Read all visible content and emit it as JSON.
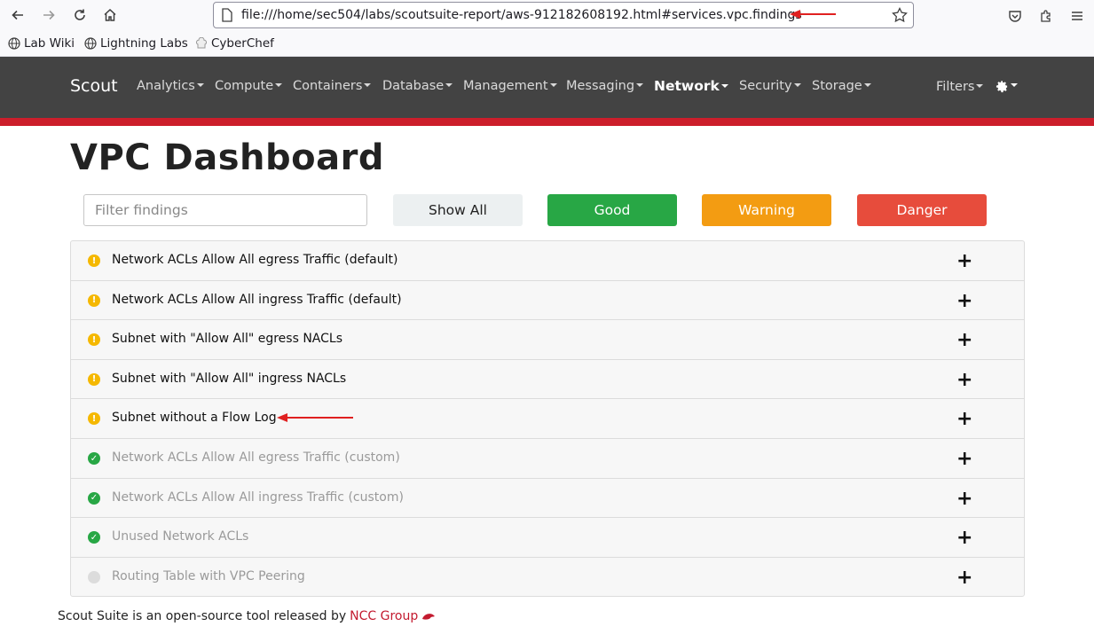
{
  "browser": {
    "url": "file:///home/sec504/labs/scoutsuite-report/aws-912182608192.html#services.vpc.findings",
    "bookmarks": [
      "Lab Wiki",
      "Lightning Labs",
      "CyberChef"
    ]
  },
  "navbar": {
    "brand": "Scout",
    "items": [
      "Analytics",
      "Compute",
      "Containers",
      "Database",
      "Management",
      "Messaging",
      "Network",
      "Security",
      "Storage"
    ],
    "active": "Network",
    "filters": "Filters"
  },
  "page": {
    "title": "VPC Dashboard",
    "filter_placeholder": "Filter findings",
    "buttons": {
      "show_all": "Show All",
      "good": "Good",
      "warning": "Warning",
      "danger": "Danger"
    }
  },
  "findings": [
    {
      "label": "Network ACLs Allow All egress Traffic (default)",
      "status": "warning"
    },
    {
      "label": "Network ACLs Allow All ingress Traffic (default)",
      "status": "warning"
    },
    {
      "label": "Subnet with \"Allow All\" egress NACLs",
      "status": "warning"
    },
    {
      "label": "Subnet with \"Allow All\" ingress NACLs",
      "status": "warning"
    },
    {
      "label": "Subnet without a Flow Log",
      "status": "warning"
    },
    {
      "label": "Network ACLs Allow All egress Traffic (custom)",
      "status": "good"
    },
    {
      "label": "Network ACLs Allow All ingress Traffic (custom)",
      "status": "good"
    },
    {
      "label": "Unused Network ACLs",
      "status": "good"
    },
    {
      "label": "Routing Table with VPC Peering",
      "status": "none"
    }
  ],
  "footer": {
    "text": "Scout Suite is an open-source tool released by",
    "link": "NCC Group"
  },
  "colors": {
    "navbar": "#434343",
    "accent_red": "#cc1e2b",
    "good": "#28a745",
    "warning": "#f39c12",
    "danger": "#e74c3c",
    "show_all": "#ecf0f1"
  }
}
